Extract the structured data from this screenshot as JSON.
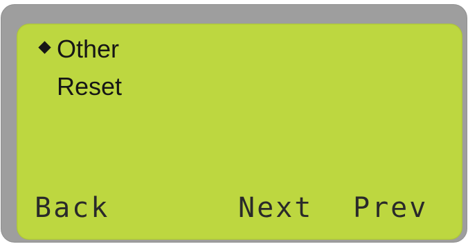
{
  "menu": {
    "items": [
      {
        "label": "Other",
        "selected": true
      },
      {
        "label": "Reset",
        "selected": false
      }
    ],
    "cursor_icon": "diamond-icon"
  },
  "softkeys": {
    "back": "Back",
    "next": "Next",
    "prev": "Prev"
  },
  "colors": {
    "screen_background": "#bdd740",
    "bezel": "#9e9e9e",
    "text": "#161616"
  }
}
